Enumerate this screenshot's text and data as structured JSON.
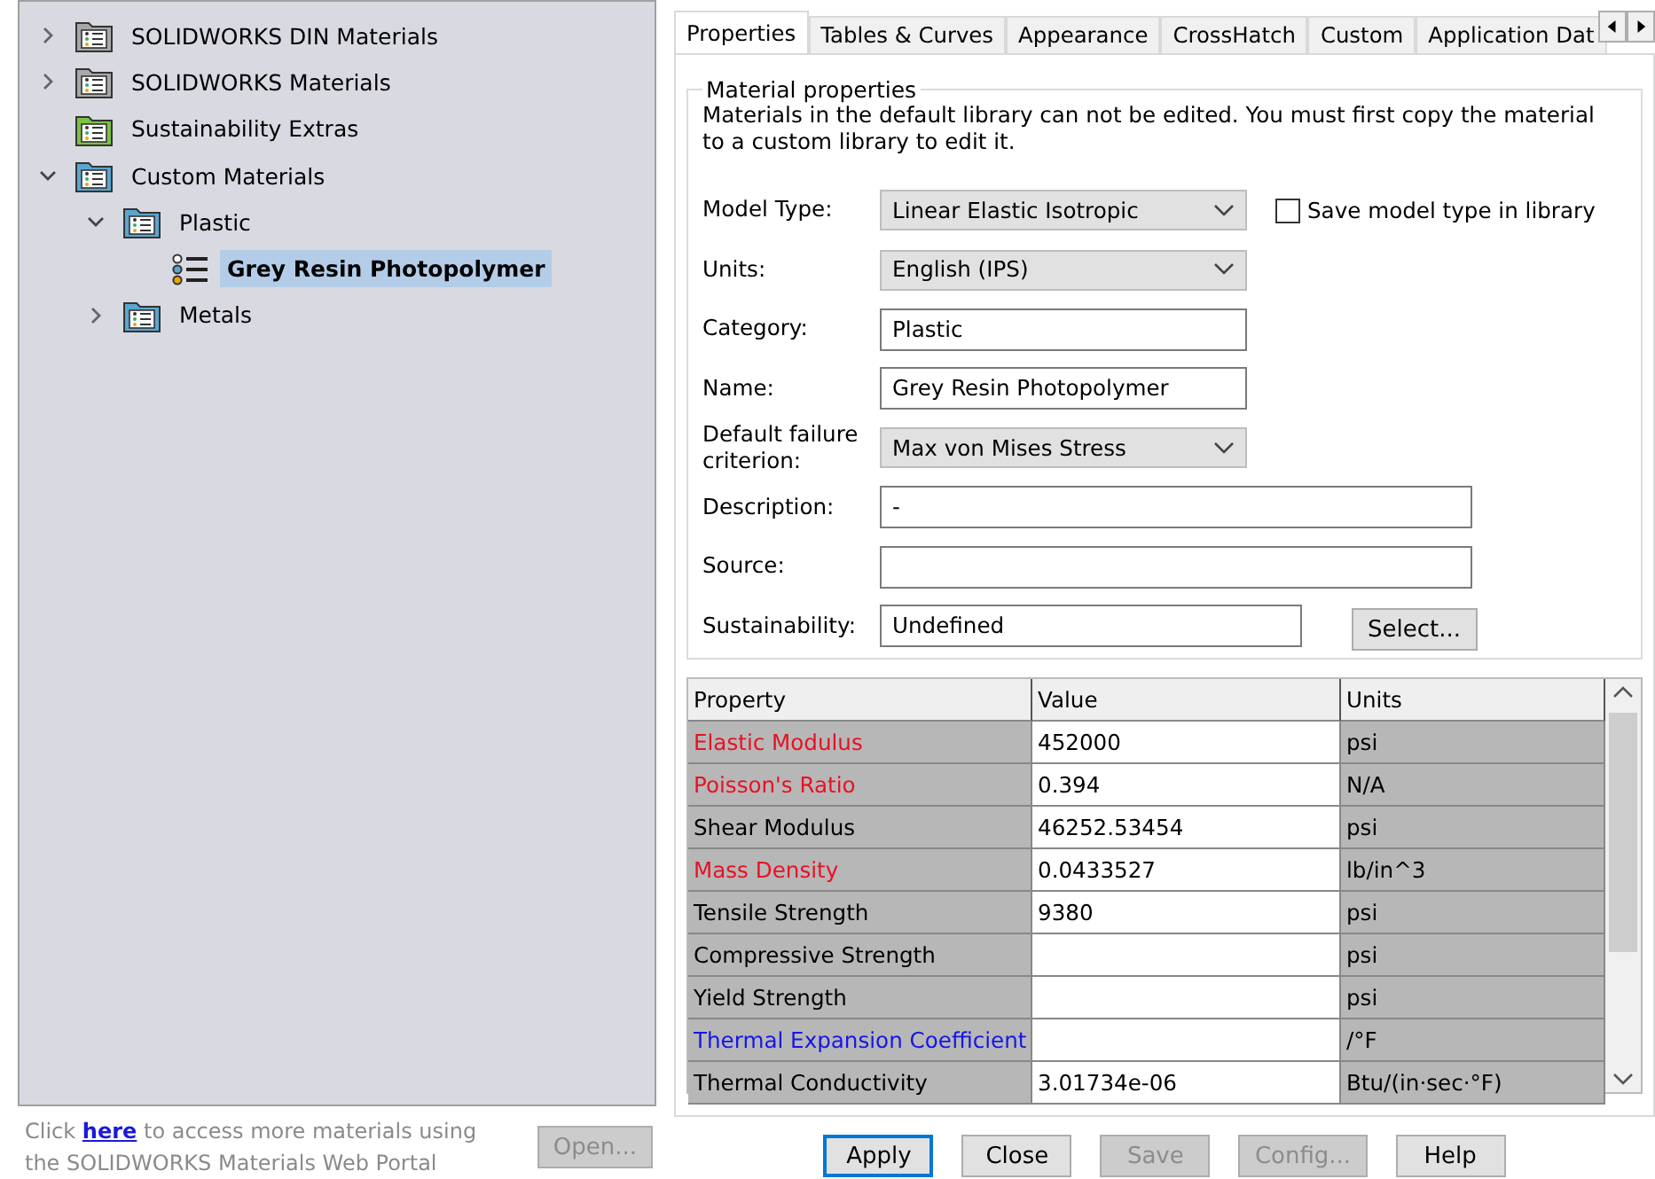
{
  "tree": [
    {
      "label": "SOLIDWORKS DIN Materials",
      "expanded": false,
      "selected": false,
      "kind": "library",
      "color": "#a8a8a8"
    },
    {
      "label": "SOLIDWORKS Materials",
      "expanded": false,
      "selected": false,
      "kind": "library",
      "color": "#a8a8a8"
    },
    {
      "label": "Sustainability Extras",
      "selected": false,
      "kind": "library",
      "color": "#7cc242"
    },
    {
      "label": "Custom Materials",
      "expanded": true,
      "selected": false,
      "kind": "library",
      "color": "#5aa6d0",
      "children": [
        {
          "label": "Plastic",
          "expanded": true,
          "selected": false,
          "kind": "library",
          "color": "#5aa6d0",
          "children": [
            {
              "label": "Grey Resin Photopolymer",
              "selected": true,
              "kind": "material"
            }
          ]
        },
        {
          "label": "Metals",
          "expanded": false,
          "selected": false,
          "kind": "library",
          "color": "#5aa6d0"
        }
      ]
    }
  ],
  "footer_text": {
    "before": "Click ",
    "link": "here",
    "after": " to access more materials using the SOLIDWORKS Materials Web Portal"
  },
  "open_button": {
    "label": "Open...",
    "disabled": true
  },
  "tabs": [
    {
      "label": "Properties",
      "selected": true
    },
    {
      "label": "Tables & Curves",
      "selected": false
    },
    {
      "label": "Appearance",
      "selected": false
    },
    {
      "label": "CrossHatch",
      "selected": false
    },
    {
      "label": "Custom",
      "selected": false
    },
    {
      "label": "Application Dat",
      "selected": false
    }
  ],
  "group_title": "Material properties",
  "notice": "Materials in the default library can not be edited. You must first copy the material to a custom library to edit it.",
  "fields": [
    {
      "label": "Model Type:",
      "value": "Linear Elastic Isotropic",
      "kind": "dropdown"
    },
    {
      "label": "Units:",
      "value": "English (IPS)",
      "kind": "dropdown"
    },
    {
      "label": "Category:",
      "value": "Plastic",
      "kind": "text"
    },
    {
      "label": "Name:",
      "value": "Grey Resin Photopolymer",
      "kind": "text"
    },
    {
      "label": "Default failure criterion:",
      "value": "Max von Mises Stress",
      "kind": "dropdown"
    },
    {
      "label": "Description:",
      "value": "-",
      "kind": "text"
    },
    {
      "label": "Source:",
      "kind": "text"
    },
    {
      "label": "Sustainability:",
      "value": "Undefined",
      "kind": "text"
    }
  ],
  "save_model_type": {
    "label": "Save model type in library",
    "checked": false
  },
  "select_button": {
    "label": "Select..."
  },
  "table": {
    "columns": [
      "Property",
      "Value",
      "Units"
    ],
    "rows": [
      {
        "property": "Elastic Modulus",
        "value": "452000",
        "units": "psi",
        "kind": "required"
      },
      {
        "property": "Poisson's Ratio",
        "value": "0.394",
        "units": "N/A",
        "kind": "required"
      },
      {
        "property": "Shear Modulus",
        "value": "46252.53454",
        "units": "psi",
        "kind": "normal"
      },
      {
        "property": "Mass Density",
        "value": "0.0433527",
        "units": "lb/in^3",
        "kind": "required"
      },
      {
        "property": "Tensile Strength",
        "value": "9380",
        "units": "psi",
        "kind": "normal"
      },
      {
        "property": "Compressive Strength",
        "value": "",
        "units": "psi",
        "kind": "normal"
      },
      {
        "property": "Yield Strength",
        "value": "",
        "units": "psi",
        "kind": "normal"
      },
      {
        "property": "Thermal Expansion Coefficient",
        "value": "",
        "units": "/°F",
        "kind": "desired"
      },
      {
        "property": "Thermal Conductivity",
        "value": "3.01734e-06",
        "units": "Btu/(in·sec·°F)",
        "kind": "normal"
      }
    ]
  },
  "buttons": [
    {
      "label": "Apply",
      "disabled": false,
      "default": true
    },
    {
      "label": "Close",
      "disabled": false,
      "default": false
    },
    {
      "label": "Save",
      "disabled": true,
      "default": false
    },
    {
      "label": "Config...",
      "disabled": true,
      "default": false
    },
    {
      "label": "Help",
      "disabled": false,
      "default": false
    }
  ]
}
